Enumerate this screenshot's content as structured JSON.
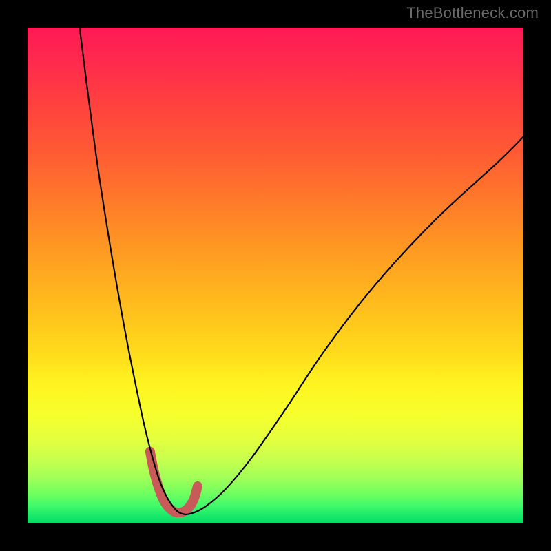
{
  "watermark": "TheBottleneck.com",
  "chart_data": {
    "type": "line",
    "title": "",
    "xlabel": "",
    "ylabel": "",
    "xlim": [
      0,
      100
    ],
    "ylim": [
      0,
      100
    ],
    "grid": false,
    "legend": false,
    "series": [
      {
        "name": "curve",
        "color": "#000000",
        "stroke_width": 2.2,
        "x": [
          10.5,
          12,
          14,
          16,
          18,
          20,
          22,
          23.5,
          25,
          26.5,
          28,
          29.5,
          31,
          33,
          36,
          40,
          45,
          52,
          60,
          70,
          82,
          95,
          100
        ],
        "y": [
          100,
          88,
          73,
          60,
          48,
          37,
          27,
          20,
          14,
          9,
          5.5,
          3.2,
          2.0,
          2.0,
          3.5,
          7,
          13,
          23,
          35,
          48,
          61,
          73,
          78
        ]
      },
      {
        "name": "highlight",
        "color": "#c85a5a",
        "stroke_width": 14,
        "linecap": "round",
        "x": [
          24.7,
          25.5,
          26.5,
          27.5,
          28.5,
          29.5,
          30.5,
          31.5,
          32.5,
          33.5,
          34.3
        ],
        "y": [
          14.5,
          10.5,
          7.0,
          4.6,
          3.2,
          2.4,
          2.2,
          2.4,
          3.2,
          4.8,
          7.5
        ]
      }
    ],
    "annotations": []
  },
  "colors": {
    "background_frame": "#000000",
    "curve": "#000000",
    "highlight": "#c85a5a",
    "watermark": "#6b6b6b"
  }
}
